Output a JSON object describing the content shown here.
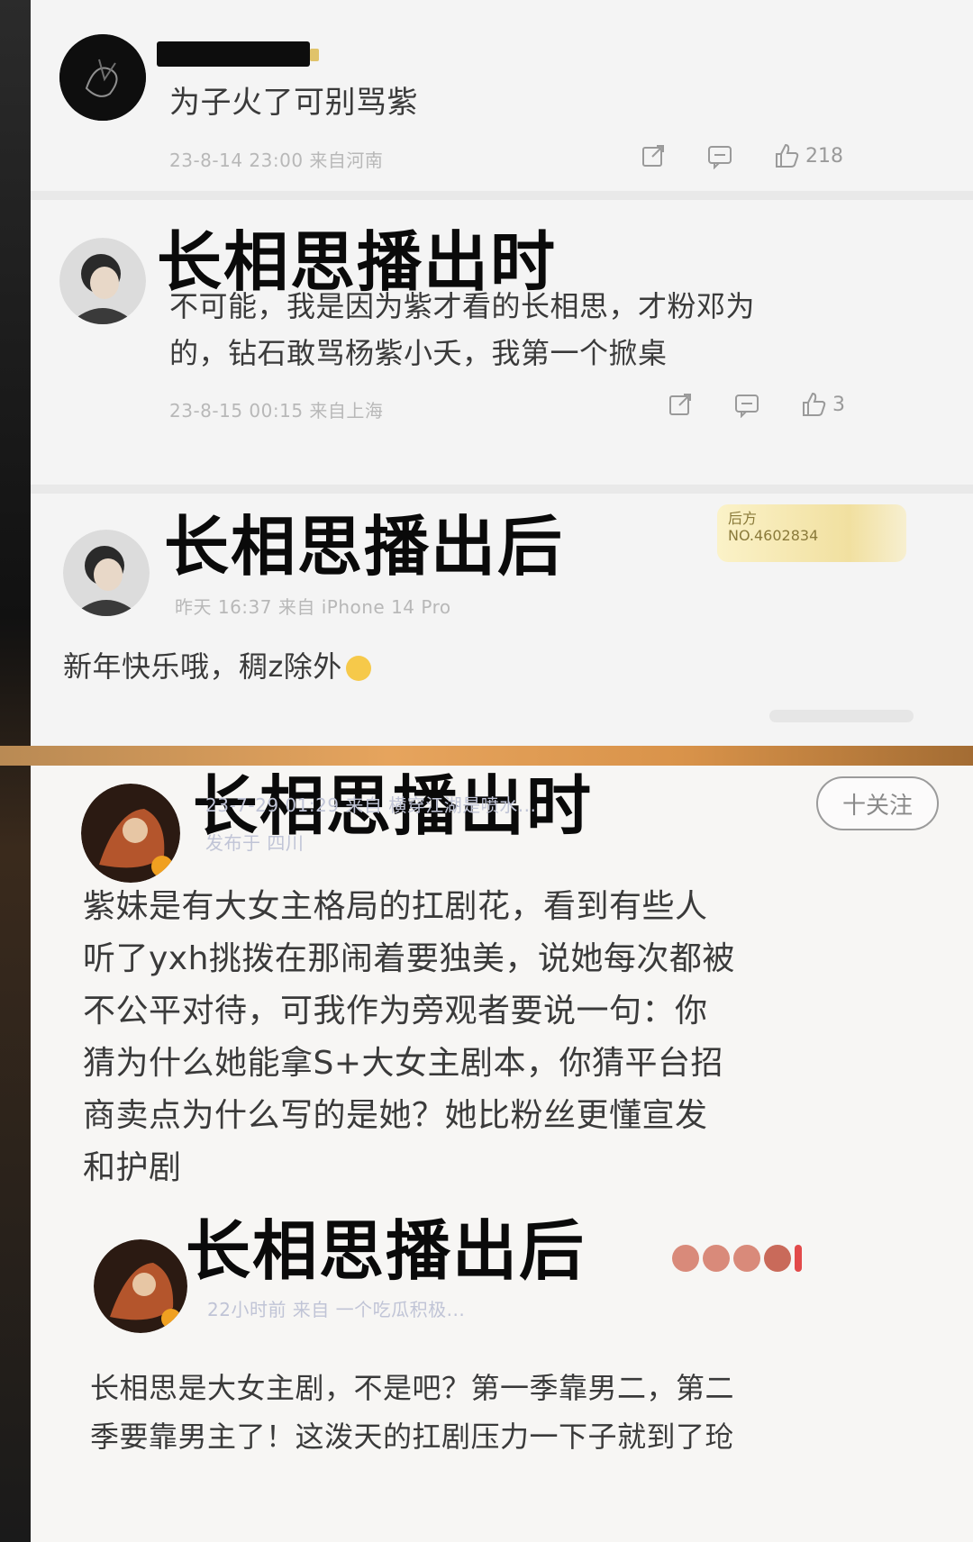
{
  "comments_top": [
    {
      "text": "为子火了可别骂紫",
      "meta": "23-8-14 23:00 来自河南",
      "likes": "218"
    },
    {
      "overlay": "长相思播出时",
      "text_line1": "不可能，我是因为紫才看的长相思，才粉邓为",
      "text_line2": "的，钻石敢骂杨紫小夭，我第一个掀桌",
      "meta": "23-8-15 00:15 来自上海",
      "likes": "3"
    },
    {
      "overlay": "长相思播出后",
      "badge_line1": "后方",
      "badge_line2": "NO.4602834",
      "meta": "昨天 16:37 来自 iPhone 14 Pro",
      "text": "新年快乐哦，稠z除外"
    }
  ],
  "post_bottom": {
    "overlay": "长相思播出时",
    "follow": "十关注",
    "meta_line1": "23-7-29 01:29 来自 横穿江湖是喷水...",
    "meta_line2": "发布于 四川",
    "body_lines": [
      "紫妹是有大女主格局的扛剧花，看到有些人",
      "听了yxh挑拨在那闹着要独美，说她每次都被",
      "不公平对待，可我作为旁观者要说一句：你",
      "猜为什么她能拿S+大女主剧本，你猜平台招",
      "商卖点为什么写的是她？她比粉丝更懂宣发",
      "和护剧"
    ]
  },
  "reply_bottom": {
    "overlay": "长相思播出后",
    "meta": "22小时前 来自 一个吃瓜积极...",
    "body_lines": [
      "长相思是大女主剧，不是吧？第一季靠男二，第二",
      "季要靠男主了！这泼天的扛剧压力一下子就到了玱"
    ]
  },
  "icons": {
    "share": "share-icon",
    "comment": "comment-icon",
    "like": "thumbs-up-icon"
  }
}
